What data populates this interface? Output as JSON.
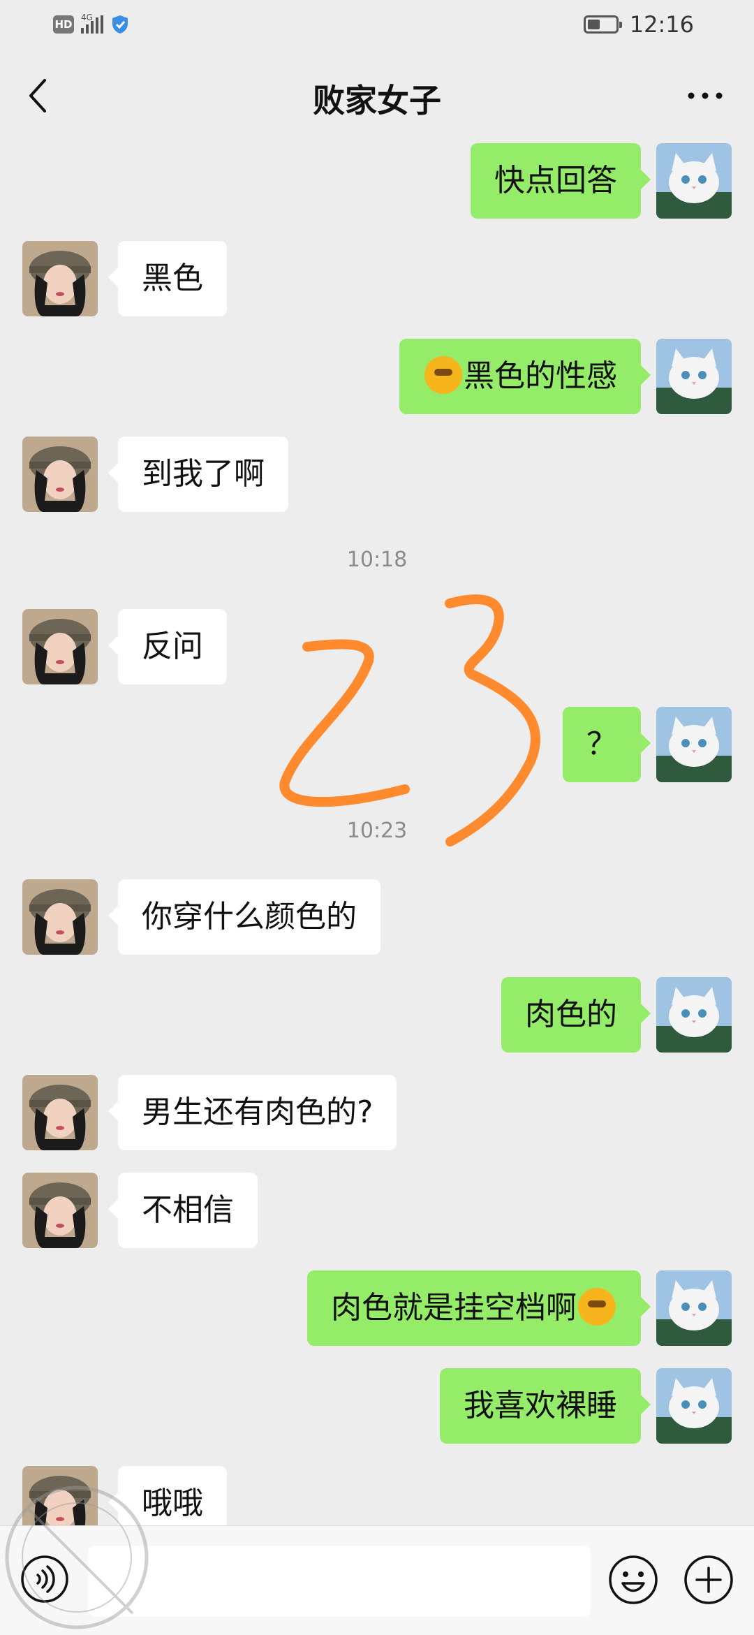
{
  "status_bar": {
    "network": "4G",
    "hd_label": "HD",
    "time": "12:16",
    "battery_level": 0.45
  },
  "header": {
    "title": "败家女子",
    "back_icon": "chevron-left-icon",
    "more_icon": "more-horizontal-icon"
  },
  "messages": [
    {
      "from": "me",
      "text": "快点回答"
    },
    {
      "from": "other",
      "text": "黑色"
    },
    {
      "from": "me",
      "emoji": "face-with-hand-over-mouth",
      "text": "黑色的性感"
    },
    {
      "from": "other",
      "text": "到我了啊"
    },
    {
      "type": "time",
      "text": "10:18"
    },
    {
      "from": "other",
      "text": "反问"
    },
    {
      "from": "me",
      "text": "？"
    },
    {
      "type": "time",
      "text": "10:23"
    },
    {
      "from": "other",
      "text": "你穿什么颜色的"
    },
    {
      "from": "me",
      "text": "肉色的"
    },
    {
      "from": "other",
      "text": "男生还有肉色的?"
    },
    {
      "from": "other",
      "text": "不相信"
    },
    {
      "from": "me",
      "text": "肉色就是挂空档啊",
      "emoji_after": "thinking-face"
    },
    {
      "from": "me",
      "text": "我喜欢裸睡"
    },
    {
      "from": "other",
      "text": "哦哦"
    }
  ],
  "annotation": {
    "text": "23",
    "color": "#ff8a2e"
  },
  "input_bar": {
    "voice_icon": "voice-icon",
    "emoji_icon": "smiley-icon",
    "plus_icon": "plus-icon",
    "placeholder": ""
  },
  "colors": {
    "my_bubble": "#95ec69",
    "other_bubble": "#ffffff",
    "background": "#ededed"
  }
}
